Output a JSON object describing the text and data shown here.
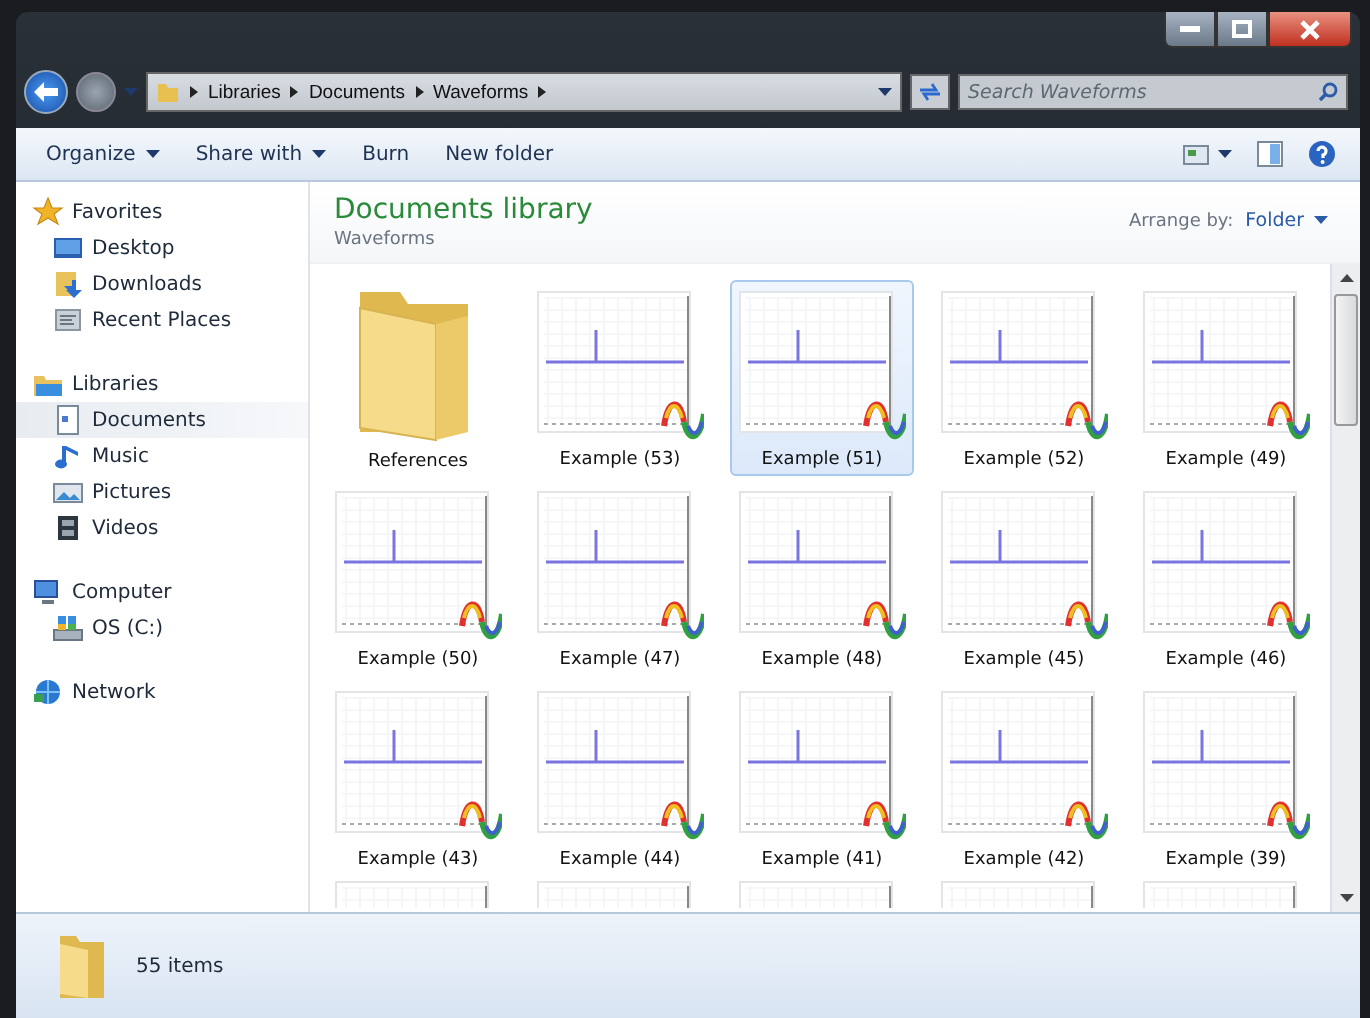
{
  "address_bar": {
    "breadcrumbs": [
      "Libraries",
      "Documents",
      "Waveforms"
    ]
  },
  "search": {
    "placeholder": "Search Waveforms"
  },
  "toolbar": {
    "buttons": [
      {
        "label": "Organize",
        "dropdown": true
      },
      {
        "label": "Share with",
        "dropdown": true
      },
      {
        "label": "Burn",
        "dropdown": false
      },
      {
        "label": "New folder",
        "dropdown": false
      }
    ]
  },
  "sidebar": {
    "groups": [
      {
        "label": "Favorites",
        "kind": "star",
        "children": [
          {
            "label": "Desktop",
            "kind": "desktop",
            "selected": false
          },
          {
            "label": "Downloads",
            "kind": "downloads",
            "selected": false
          },
          {
            "label": "Recent Places",
            "kind": "recent",
            "selected": false
          }
        ]
      },
      {
        "label": "Libraries",
        "kind": "library",
        "children": [
          {
            "label": "Documents",
            "kind": "document",
            "selected": true
          },
          {
            "label": "Music",
            "kind": "music",
            "selected": false
          },
          {
            "label": "Pictures",
            "kind": "pictures",
            "selected": false
          },
          {
            "label": "Videos",
            "kind": "videos",
            "selected": false
          }
        ]
      },
      {
        "label": "Computer",
        "kind": "computer",
        "children": [
          {
            "label": "OS (C:)",
            "kind": "drive",
            "selected": false
          }
        ]
      },
      {
        "label": "Network",
        "kind": "network"
      }
    ]
  },
  "content": {
    "title": "Documents library",
    "subtitle": "Waveforms",
    "arrange_label": "Arrange by:",
    "arrange_value": "Folder",
    "items": [
      {
        "name": "References",
        "kind": "folder",
        "selected": false
      },
      {
        "name": "Example (53)",
        "kind": "waveform",
        "selected": false
      },
      {
        "name": "Example (51)",
        "kind": "waveform",
        "selected": true
      },
      {
        "name": "Example (52)",
        "kind": "waveform",
        "selected": false
      },
      {
        "name": "Example (49)",
        "kind": "waveform",
        "selected": false
      },
      {
        "name": "Example (50)",
        "kind": "waveform",
        "selected": false
      },
      {
        "name": "Example (47)",
        "kind": "waveform",
        "selected": false
      },
      {
        "name": "Example (48)",
        "kind": "waveform",
        "selected": false
      },
      {
        "name": "Example (45)",
        "kind": "waveform",
        "selected": false
      },
      {
        "name": "Example (46)",
        "kind": "waveform",
        "selected": false
      },
      {
        "name": "Example (43)",
        "kind": "waveform",
        "selected": false
      },
      {
        "name": "Example (44)",
        "kind": "waveform",
        "selected": false
      },
      {
        "name": "Example (41)",
        "kind": "waveform",
        "selected": false
      },
      {
        "name": "Example (42)",
        "kind": "waveform",
        "selected": false
      },
      {
        "name": "Example (39)",
        "kind": "waveform",
        "selected": false
      }
    ]
  },
  "status_bar": {
    "text": "55 items"
  }
}
